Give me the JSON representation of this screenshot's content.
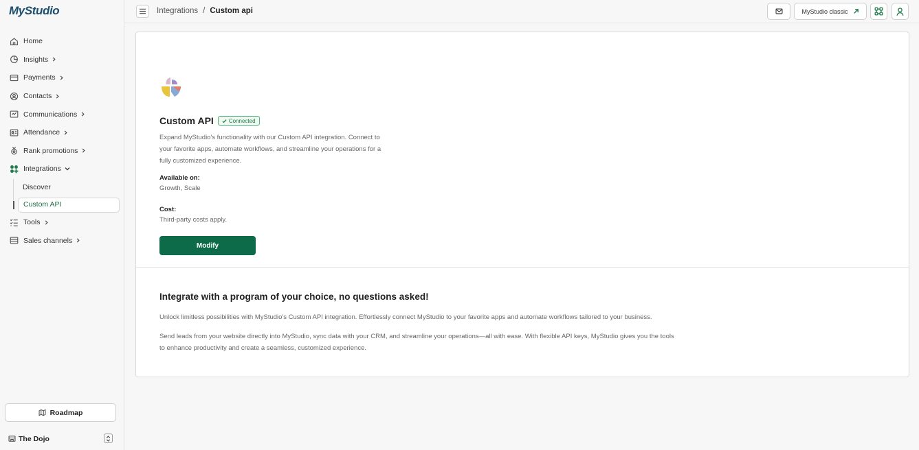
{
  "app": {
    "logo_text": "MyStudio"
  },
  "sidebar": {
    "items": [
      {
        "label": "Home",
        "icon": "home-icon",
        "chevron": false
      },
      {
        "label": "Insights",
        "icon": "pie-chart-icon",
        "chevron": true
      },
      {
        "label": "Payments",
        "icon": "card-icon",
        "chevron": true
      },
      {
        "label": "Contacts",
        "icon": "user-circle-icon",
        "chevron": true
      },
      {
        "label": "Communications",
        "icon": "message-icon",
        "chevron": true
      },
      {
        "label": "Attendance",
        "icon": "id-card-icon",
        "chevron": true
      },
      {
        "label": "Rank promotions",
        "icon": "medal-icon",
        "chevron": true
      },
      {
        "label": "Integrations",
        "icon": "apps-icon",
        "chevron": "down"
      }
    ],
    "sub_items": [
      {
        "label": "Discover"
      },
      {
        "label": "Custom API",
        "active": true
      }
    ],
    "items_after": [
      {
        "label": "Tools",
        "icon": "list-check-icon",
        "chevron": true
      },
      {
        "label": "Sales channels",
        "icon": "store-icon",
        "chevron": true
      }
    ],
    "roadmap_label": "Roadmap",
    "workspace_name": "The Dojo"
  },
  "topbar": {
    "breadcrumb": [
      "Integrations",
      "Custom api"
    ],
    "classic_label": "MyStudio classic"
  },
  "integration": {
    "name": "Custom API",
    "status": "Connected",
    "description": "Expand MyStudio's functionality with our Custom API integration. Connect to your favorite apps, automate workflows, and streamline your operations for a fully customized experience.",
    "available_label": "Available on:",
    "available_value": "Growth, Scale",
    "cost_label": "Cost:",
    "cost_value": "Third-party costs apply.",
    "modify_label": "Modify"
  },
  "info": {
    "title": "Integrate with a program of your choice, no questions asked!",
    "p1": "Unlock limitless possibilities with MyStudio's Custom API integration. Effortlessly connect MyStudio to your favorite apps and automate workflows tailored to your business.",
    "p2": "Send leads from your website directly into MyStudio, sync data with your CRM, and streamline your operations—all with ease. With flexible API keys, MyStudio gives you the tools to enhance productivity and create a seamless, customized experience."
  },
  "colors": {
    "accent": "#0e6b4a",
    "brand": "#1d4f6e",
    "badge_border": "#4fb37c"
  }
}
